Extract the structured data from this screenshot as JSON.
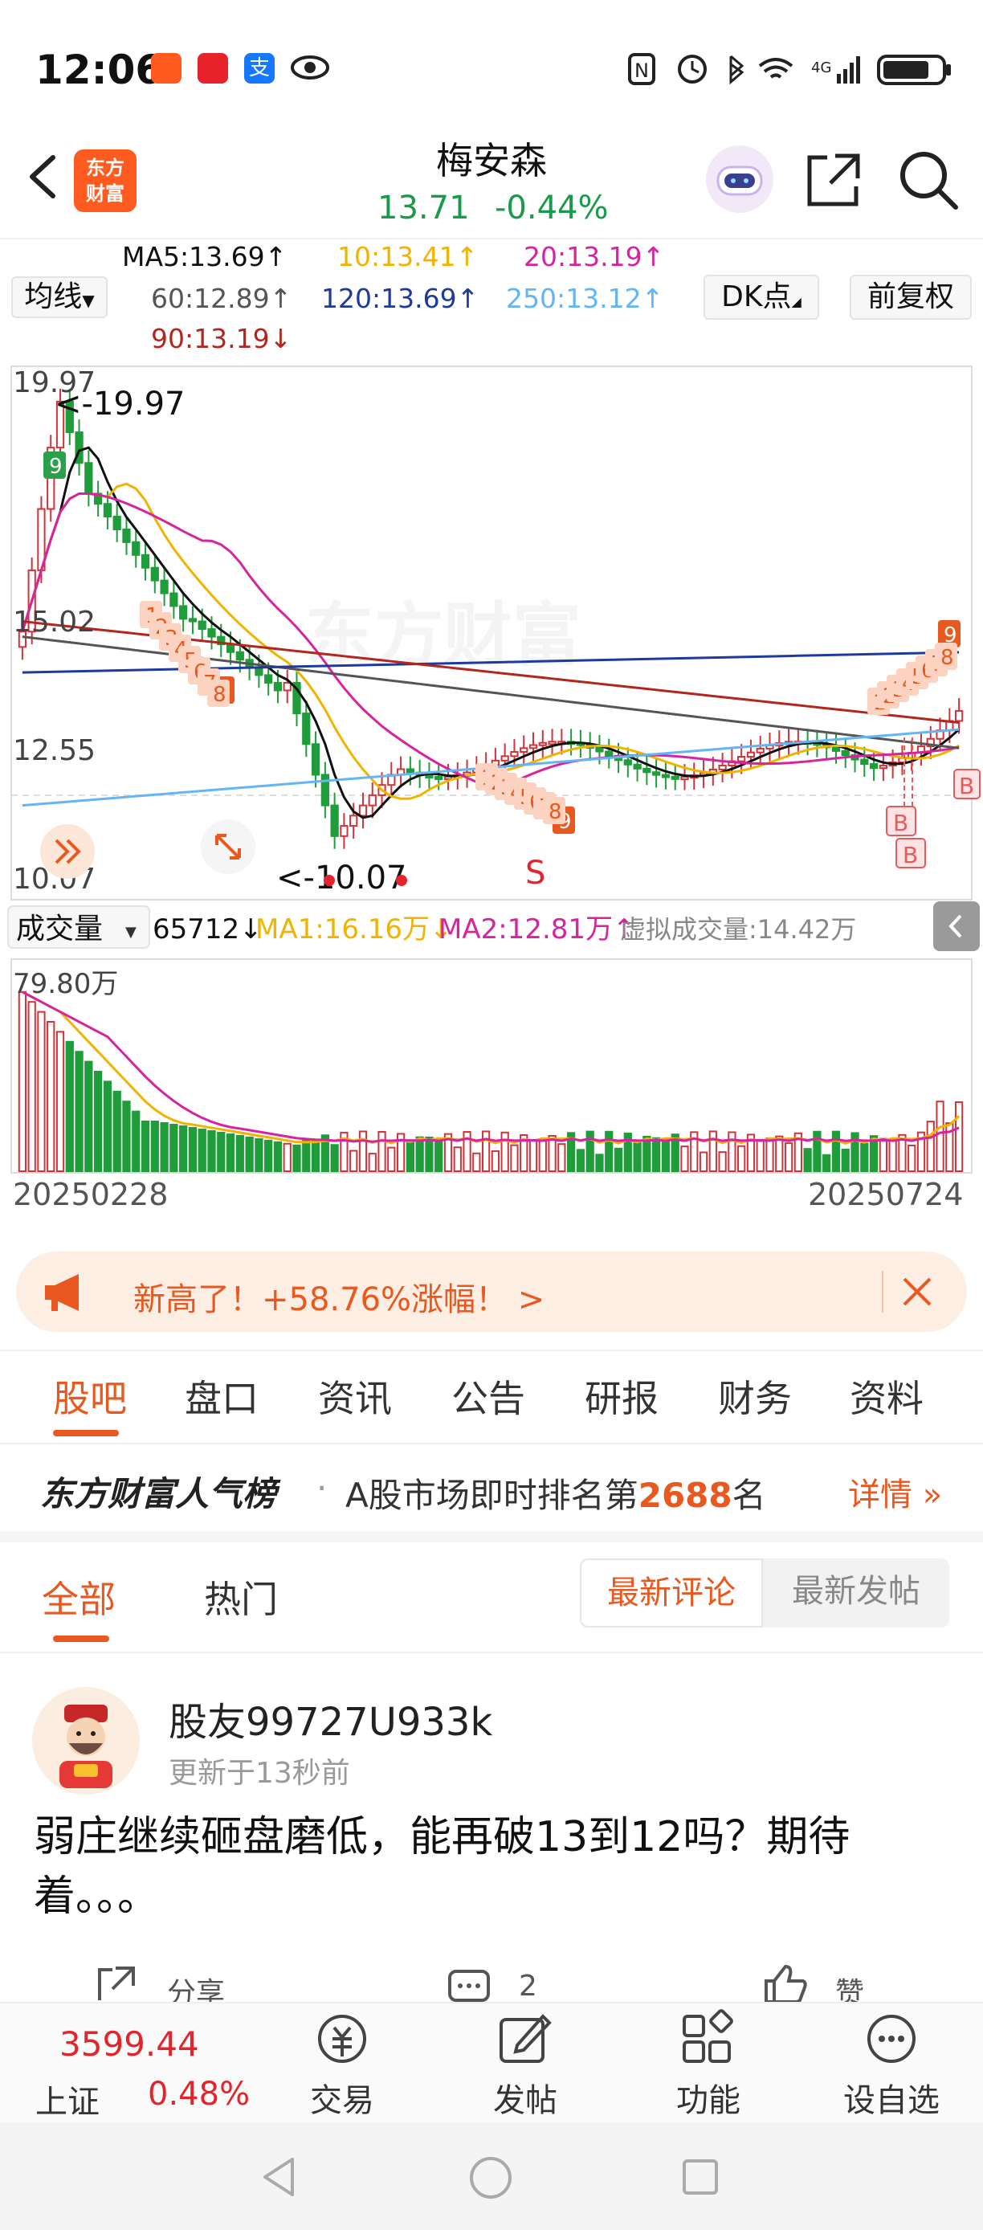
{
  "status_bar": {
    "time": "12:06"
  },
  "header": {
    "logo_text_line1": "东方",
    "logo_text_line2": "财富",
    "stock_name": "梅安森",
    "price": "13.71",
    "change": "-0.44%"
  },
  "ma_legend": {
    "selector_label": "均线",
    "ma5": "MA5:13.69↑",
    "ma10": "10:13.41↑",
    "ma20": "20:13.19↑",
    "ma60": "60:12.89↑",
    "ma120": "120:13.69↑",
    "ma250": "250:13.12↑",
    "ma90": "90:13.19↓",
    "dk_label": "DK点",
    "adjust_label": "前复权"
  },
  "chart": {
    "y_top_label": "19.97",
    "y_mid1_label": "15.02",
    "y_mid2_label": "12.55",
    "y_bottom_label": "10.07",
    "high_marker": "<-19.97",
    "low_marker": "<-10.07",
    "sell_marker": "S",
    "buy_marker": "B",
    "watermark": "东方财富",
    "volume_selector": "成交量",
    "volume_value": "65712↓",
    "vol_ma1": "MA1:16.16万↓",
    "vol_ma2": "MA2:12.81万↑",
    "virtual_volume": "虚拟成交量:14.42万",
    "vol_max_label": "79.80万",
    "start_date": "20250228",
    "end_date": "20250724",
    "colors": {
      "up": "#d0343a",
      "down": "#1f9d3a",
      "ma5": "#111111",
      "ma10": "#f0b400",
      "ma20": "#d6249f",
      "ma60": "#555555",
      "ma120": "#1e3a9e",
      "ma250": "#64b5f6",
      "ma90": "#b3261e"
    }
  },
  "banner": {
    "text": "新高了！+58.76%涨幅！ >"
  },
  "tabs": [
    "股吧",
    "盘口",
    "资讯",
    "公告",
    "研报",
    "财务",
    "资料"
  ],
  "rank": {
    "brand": "东方财富人气榜",
    "dot": "·",
    "text_prefix": "A股市场即时排名第",
    "rank_number": "2688",
    "text_suffix": "名",
    "details": "详情"
  },
  "filter": {
    "all": "全部",
    "hot": "热门",
    "latest_comments": "最新评论",
    "latest_posts": "最新发帖"
  },
  "post": {
    "username": "股友99727U933k",
    "updated": "更新于13秒前",
    "content": "弱庄继续砸盘磨低，能再破13到12吗？期待着。。。",
    "share_label": "分享",
    "comment_count": "2",
    "like_label": "赞"
  },
  "bottom_nav": {
    "index_value": "3599.44",
    "index_name": "上证",
    "index_change": "0.48%",
    "trade": "交易",
    "post": "发帖",
    "function": "功能",
    "watchlist": "设自选"
  }
}
